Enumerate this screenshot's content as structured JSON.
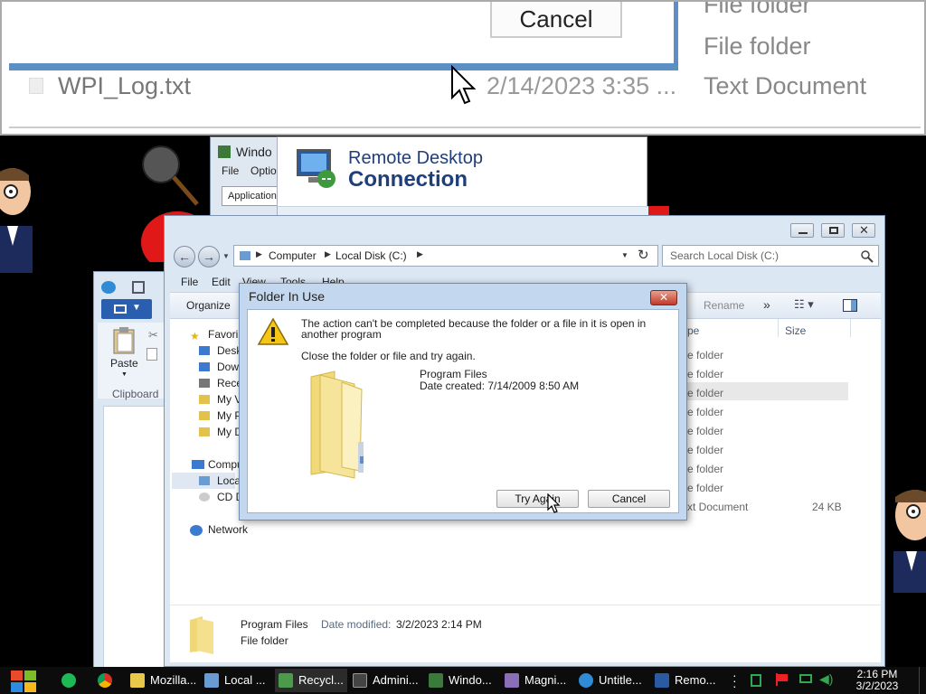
{
  "magnifier": {
    "cancel_label": "Cancel",
    "type_top_cut": "File folder",
    "type_file_folder": "File folder",
    "file_name": "WPI_Log.txt",
    "file_date": "2/14/2023 3:35 ...",
    "file_type": "Text Document"
  },
  "rdp": {
    "title_line1": "Remote Desktop",
    "title_line2": "Connection"
  },
  "task_manager": {
    "title": "Windo",
    "menu_file": "File",
    "menu_options": "Optio",
    "tab_applications": "Applications"
  },
  "explorer": {
    "breadcrumb": [
      "Computer",
      "Local Disk (C:)"
    ],
    "search_placeholder": "Search Local Disk (C:)",
    "menu": [
      "File",
      "Edit",
      "View",
      "Tools",
      "Help"
    ],
    "organize_label": "Organize",
    "rename_label": "Rename",
    "more_label": "»",
    "col_type": "pe",
    "col_size": "Size",
    "rows": [
      {
        "type": "e folder",
        "size": ""
      },
      {
        "type": "e folder",
        "size": ""
      },
      {
        "type": "e folder",
        "size": ""
      },
      {
        "type": "e folder",
        "size": ""
      },
      {
        "type": "e folder",
        "size": ""
      },
      {
        "type": "e folder",
        "size": ""
      },
      {
        "type": "e folder",
        "size": ""
      },
      {
        "type": "e folder",
        "size": ""
      },
      {
        "type": "xt Document",
        "size": "24 KB"
      }
    ],
    "nav": {
      "favorites": "Favori",
      "desktop": "Desk",
      "downloads": "Dow",
      "recent": "Rece",
      "myv": "My V",
      "myp": "My P",
      "myd": "My D",
      "computer": "Compu",
      "local": "Loca",
      "cd": "CD D",
      "network": "Network"
    },
    "details_name": "Program Files",
    "details_modified_label": "Date modified:",
    "details_modified_value": "3/2/2023 2:14 PM",
    "details_type": "File folder"
  },
  "wordpad": {
    "paste_label": "Paste",
    "clipboard_label": "Clipboard"
  },
  "dialog": {
    "title": "Folder In Use",
    "message": "The action can't be completed because the folder or a file in it is open in another program",
    "hint": "Close the folder or file and try again.",
    "item_name": "Program Files",
    "item_date": "Date created: 7/14/2009 8:50 AM",
    "try_again": "Try Again",
    "cancel": "Cancel"
  },
  "taskbar": {
    "items": [
      {
        "label": "Mozilla...",
        "color": "#e8c84a"
      },
      {
        "label": "Local ...",
        "color": "#6a9cd4"
      },
      {
        "label": "Recycl...",
        "color": "#4c9a4c"
      },
      {
        "label": "Admini...",
        "color": "#444444"
      },
      {
        "label": "Windo...",
        "color": "#3b7a3b"
      },
      {
        "label": "Magni...",
        "color": "#8a6fb8"
      },
      {
        "label": "Untitle...",
        "color": "#2f8bd6"
      },
      {
        "label": "Remo...",
        "color": "#2a5aa0"
      }
    ],
    "time": "2:16 PM",
    "date": "3/2/2023"
  },
  "colors": {
    "accent": "#5d8fc4",
    "dialog_frame": "#c3d7ef",
    "taskbar": "#0c0c0c"
  }
}
